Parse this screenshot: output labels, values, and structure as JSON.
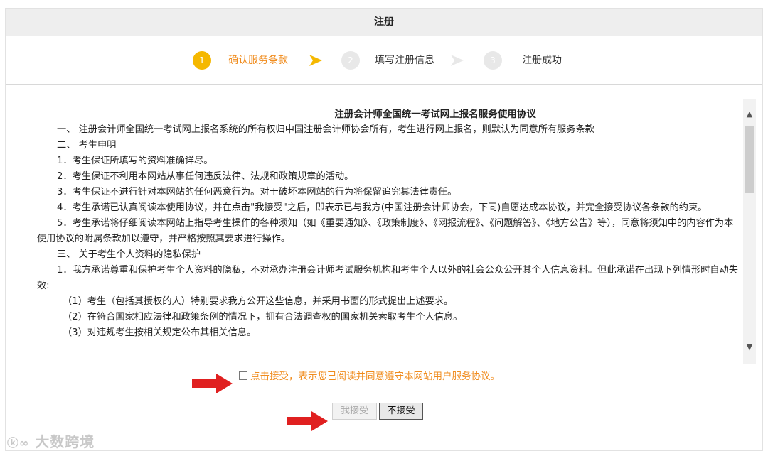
{
  "window": {
    "title": "注册"
  },
  "steps": [
    {
      "num": "1",
      "label": "确认服务条款",
      "state": "active"
    },
    {
      "num": "2",
      "label": "填写注册信息",
      "state": "inactive"
    },
    {
      "num": "3",
      "label": "注册成功",
      "state": "inactive"
    }
  ],
  "agreement": {
    "title": "注册会计师全国统一考试网上报名服务使用协议",
    "paragraphs": [
      "一、 注册会计师全国统一考试网上报名系统的所有权归中国注册会计师协会所有，考生进行网上报名，则默认为同意所有服务条款",
      "二、 考生申明",
      "1．考生保证所填写的资料准确详尽。",
      "2．考生保证不利用本网站从事任何违反法律、法规和政策规章的活动。",
      "3．考生保证不进行针对本网站的任何恶意行为。对于破坏本网站的行为将保留追究其法律责任。",
      "4．考生承诺已认真阅读本使用协议，并在点击\"我接受\"之后，即表示已与我方(中国注册会计师协会，下同)自愿达成本协议，并完全接受协议各条款的约束。",
      "5．考生承诺将仔细阅读本网站上指导考生操作的各种须知（如《重要通知》、《政策制度》、《网报流程》、《问题解答》、《地方公告》等），同意将须知中的内容作为本使用协议的附属条款加以遵守，并严格按照其要求进行操作。",
      "三、 关于考生个人资料的隐私保护",
      "1．我方承诺尊重和保护考生个人资料的隐私，不对承办注册会计师考试服务机构和考生个人以外的社会公众公开其个人信息资料。但此承诺在出现下列情形时自动失效:",
      "（1）考生（包括其授权的人）特别要求我方公开这些信息，并采用书面的形式提出上述要求。",
      "（2）在符合国家相应法律和政策条例的情况下，拥有合法调查权的国家机关索取考生个人信息。",
      "（3）对违规考生按相关规定公布其相关信息。"
    ]
  },
  "consent": {
    "label": "点击接受，表示您已阅读并同意遵守本网站用户服务协议。"
  },
  "buttons": {
    "accept": "我接受",
    "decline": "不接受"
  },
  "watermark": {
    "text": "大数跨境"
  },
  "colors": {
    "accent": "#f08c1e",
    "step_active": "#f5b800",
    "arrow_red": "#e02020"
  }
}
